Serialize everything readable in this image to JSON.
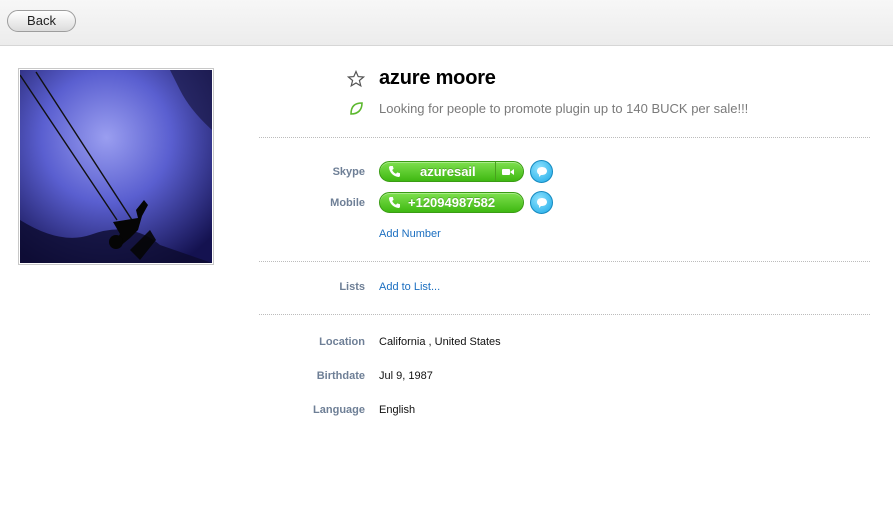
{
  "toolbar": {
    "back_label": "Back"
  },
  "profile": {
    "name": "azure moore",
    "mood": "Looking for people to promote plugin up to 140 BUCK per sale!!!"
  },
  "phones": {
    "skype_label": "Skype",
    "skype_value": "azuresail",
    "mobile_label": "Mobile",
    "mobile_value": "+12094987582",
    "add_number": "Add Number"
  },
  "lists": {
    "label": "Lists",
    "action": "Add to List..."
  },
  "details": {
    "location_label": "Location",
    "location_value": "California , United States",
    "birthdate_label": "Birthdate",
    "birthdate_value": "Jul 9, 1987",
    "language_label": "Language",
    "language_value": "English"
  },
  "colors": {
    "call_green": "#4cc21c",
    "chat_blue": "#1aa8e6",
    "label_color": "#6e7f96",
    "link_color": "#1a6ec0"
  },
  "icons": {
    "star": "star-icon",
    "mood": "mood-leaf-icon",
    "phone": "phone-icon",
    "video": "video-icon",
    "chat": "chat-bubble-icon"
  }
}
